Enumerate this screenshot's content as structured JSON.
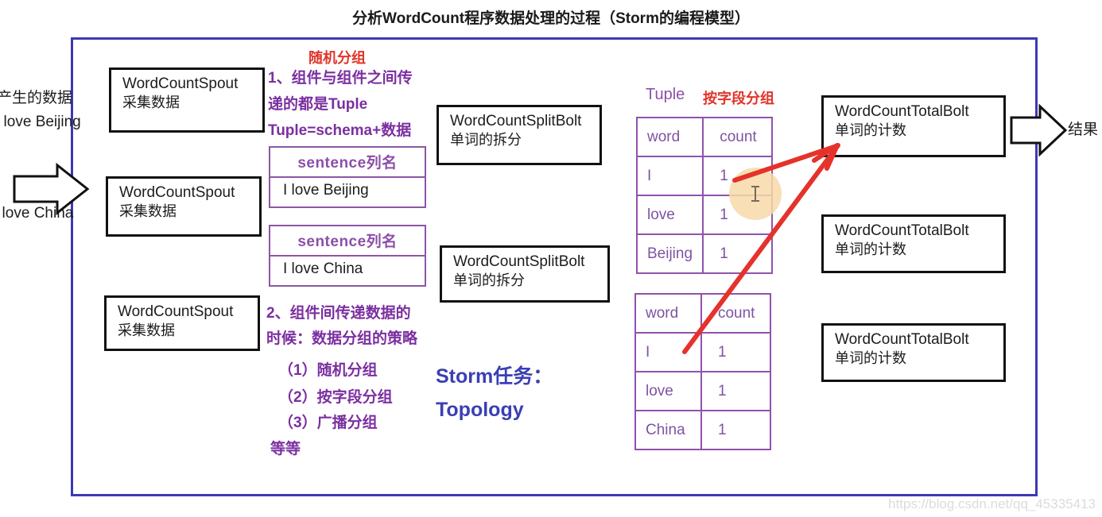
{
  "title": "分析WordCount程序数据处理的过程（Storm的编程模型）",
  "left_outside": {
    "line1": "产生的数据",
    "line2": "I love Beijing",
    "line3": "I love China"
  },
  "spouts": [
    {
      "name": "WordCountSpout",
      "desc": "采集数据"
    },
    {
      "name": "WordCountSpout",
      "desc": "采集数据"
    },
    {
      "name": "WordCountSpout",
      "desc": "采集数据"
    }
  ],
  "grouping_note_top": "随机分组",
  "notes": {
    "n1_line1": "1、组件与组件之间传",
    "n1_line2": "递的都是Tuple",
    "n1_line3": "Tuple=schema+数据",
    "n2_line1": "2、组件间传递数据的",
    "n2_line2": "时候：数据分组的策略",
    "n2_item1": "（1）随机分组",
    "n2_item2": "（2）按字段分组",
    "n2_item3": "（3）广播分组",
    "n2_item4": "等等"
  },
  "sentences": [
    {
      "header": "sentence列名",
      "value": "I love Beijing"
    },
    {
      "header": "sentence列名",
      "value": "I love China"
    }
  ],
  "split_bolts": [
    {
      "name": "WordCountSplitBolt",
      "desc": "单词的拆分"
    },
    {
      "name": "WordCountSplitBolt",
      "desc": "单词的拆分"
    }
  ],
  "topology_label": {
    "line1": "Storm任务：",
    "line2": "Topology"
  },
  "tuple_label": "Tuple",
  "field_grouping_label": "按字段分组",
  "tuple_tables": [
    {
      "headers": [
        "word",
        "count"
      ],
      "rows": [
        [
          "I",
          "1"
        ],
        [
          "love",
          "1"
        ],
        [
          "Beijing",
          "1"
        ]
      ]
    },
    {
      "headers": [
        "word",
        "count"
      ],
      "rows": [
        [
          "I",
          "1"
        ],
        [
          "love",
          "1"
        ],
        [
          "China",
          "1"
        ]
      ]
    }
  ],
  "total_bolts": [
    {
      "name": "WordCountTotalBolt",
      "desc": "单词的计数"
    },
    {
      "name": "WordCountTotalBolt",
      "desc": "单词的计数"
    },
    {
      "name": "WordCountTotalBolt",
      "desc": "单词的计数"
    }
  ],
  "result_label": "结果",
  "watermark": "https://blog.csdn.net/qq_45335413",
  "colors": {
    "frame_blue": "#3b39b5",
    "purple_text": "#7b2fa0",
    "table_purple": "#9152ac",
    "red_arrow": "#e5322b",
    "red_label": "#e0352b",
    "topology_blue": "#3a3fb5"
  }
}
